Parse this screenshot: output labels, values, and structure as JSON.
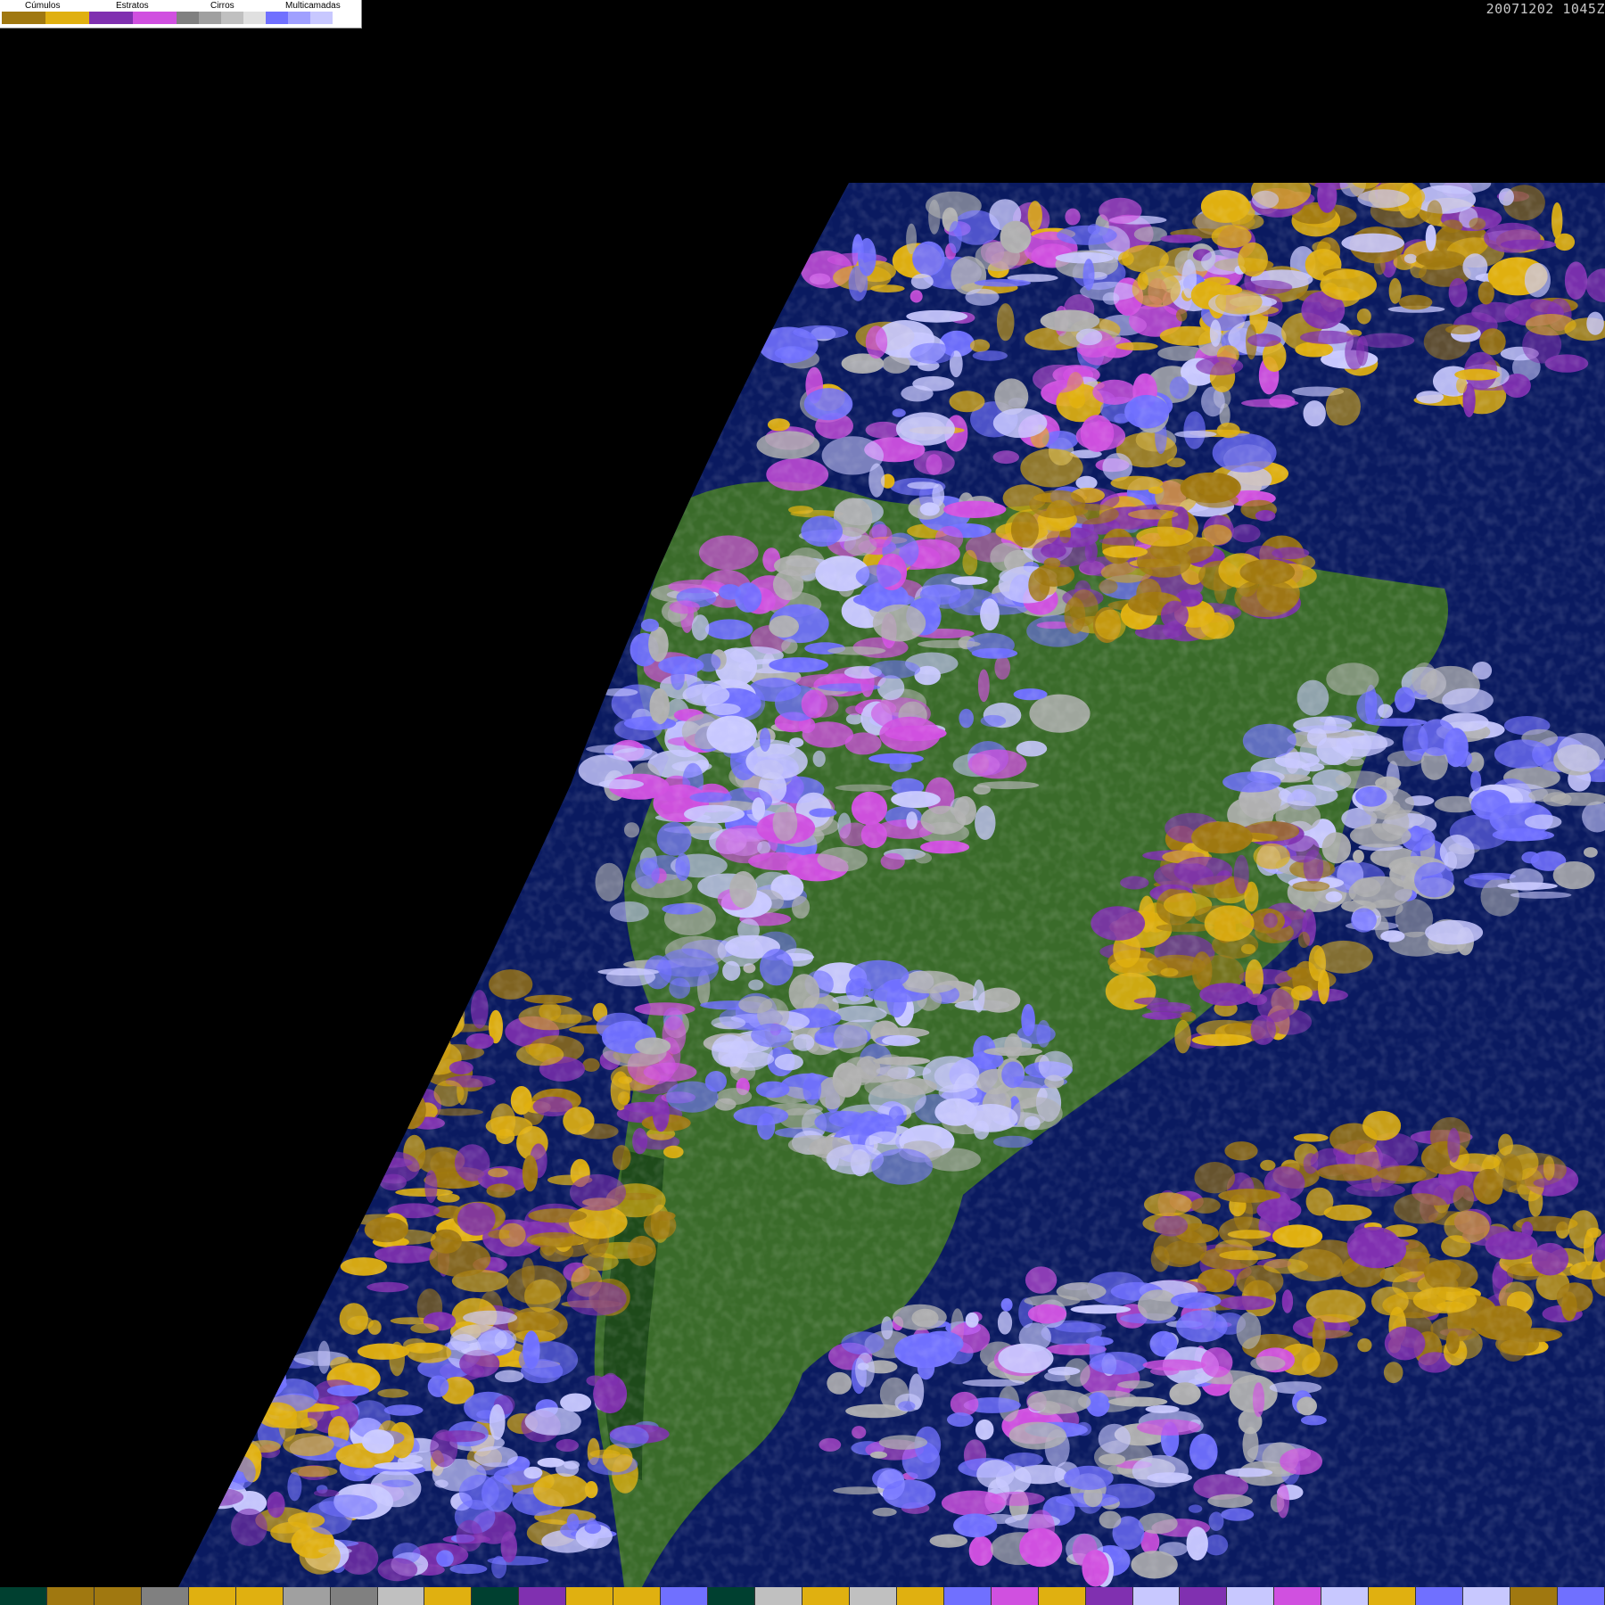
{
  "legend": {
    "groups": [
      {
        "label": "Cúmulos",
        "colors": [
          "#a07810",
          "#e0b010"
        ]
      },
      {
        "label": "Estratos",
        "colors": [
          "#8030b0",
          "#d050e0"
        ]
      },
      {
        "label": "Cirros",
        "colors": [
          "#808080",
          "#a0a0a0",
          "#c0c0c0",
          "#e0e0e0"
        ]
      },
      {
        "label": "Multicamadas",
        "colors": [
          "#7070ff",
          "#a0a0ff",
          "#c8c8ff",
          "#ffffff"
        ]
      }
    ]
  },
  "timestamp": "20071202 1045Z",
  "colors": {
    "background": "#000000",
    "ocean": "#0a1a60",
    "land": "#3a6b2a",
    "land_dark": "#1e4a1a",
    "cumulus_dark": "#a07810",
    "cumulus_light": "#e0b010",
    "stratus_dark": "#8030b0",
    "stratus_light": "#d050e0",
    "cirrus": "#b0b0b0",
    "multilayer_dark": "#7070ff",
    "multilayer_light": "#c8c8ff"
  },
  "bottom_strip": [
    "#004030",
    "#a07810",
    "#a07810",
    "#808080",
    "#e0b010",
    "#e0b010",
    "#a0a0a0",
    "#808080",
    "#c0c0c0",
    "#e0b010",
    "#004030",
    "#8030b0",
    "#e0b010",
    "#e0b010",
    "#7070ff",
    "#004030",
    "#c0c0c0",
    "#e0b010",
    "#c0c0c0",
    "#e0b010",
    "#7070ff",
    "#d050e0",
    "#e0b010",
    "#8030b0",
    "#c8c8ff",
    "#8030b0",
    "#c8c8ff",
    "#d050e0",
    "#c8c8ff",
    "#e0b010",
    "#7070ff",
    "#c8c8ff",
    "#a07810",
    "#7070ff"
  ]
}
